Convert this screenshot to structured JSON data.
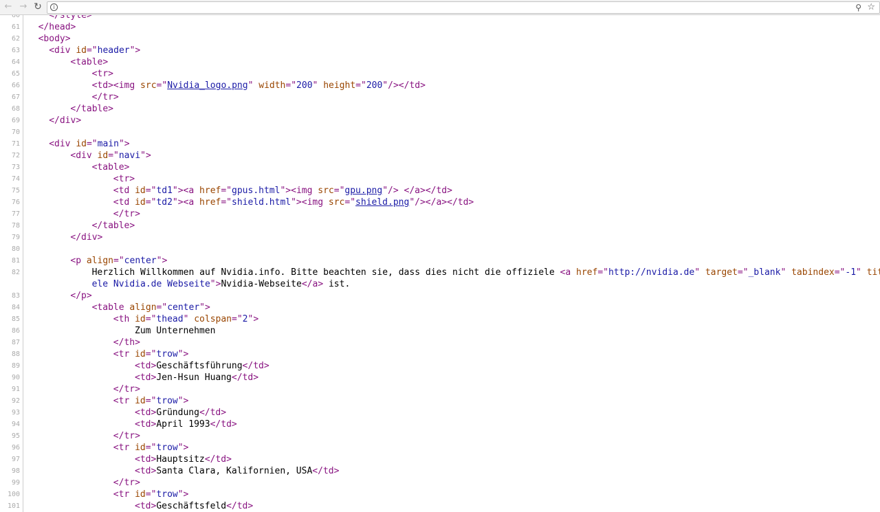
{
  "toolbar": {
    "back_icon": "back-arrow-icon",
    "forward_icon": "forward-arrow-icon",
    "reload_icon": "reload-icon",
    "info_icon": "info-icon",
    "zoom_icon": "zoom-icon",
    "bookmark_icon": "star-icon",
    "url": ""
  },
  "colors": {
    "tag": "#881280",
    "attr_name": "#994500",
    "attr_value": "#1a1aa6",
    "line_number": "#aaaaaa"
  },
  "lines": [
    {
      "n": "60",
      "indent": 4,
      "tokens": [
        [
          "t",
          "</style>"
        ]
      ]
    },
    {
      "n": "61",
      "indent": 2,
      "tokens": [
        [
          "t",
          "</head>"
        ]
      ]
    },
    {
      "n": "62",
      "indent": 2,
      "tokens": [
        [
          "t",
          "<body>"
        ]
      ]
    },
    {
      "n": "63",
      "indent": 4,
      "tokens": [
        [
          "t",
          "<div "
        ],
        [
          "a",
          "id"
        ],
        [
          "t",
          "=\""
        ],
        [
          "v",
          "header"
        ],
        [
          "t",
          "\">"
        ]
      ]
    },
    {
      "n": "64",
      "indent": 8,
      "tokens": [
        [
          "t",
          "<table>"
        ]
      ]
    },
    {
      "n": "65",
      "indent": 12,
      "tokens": [
        [
          "t",
          "<tr>"
        ]
      ]
    },
    {
      "n": "66",
      "indent": 12,
      "tokens": [
        [
          "t",
          "<td><img "
        ],
        [
          "a",
          "src"
        ],
        [
          "t",
          "=\""
        ],
        [
          "l",
          "Nvidia_logo.png"
        ],
        [
          "t",
          "\" "
        ],
        [
          "a",
          "width"
        ],
        [
          "t",
          "=\""
        ],
        [
          "v",
          "200"
        ],
        [
          "t",
          "\" "
        ],
        [
          "a",
          "height"
        ],
        [
          "t",
          "=\""
        ],
        [
          "v",
          "200"
        ],
        [
          "t",
          "\"/></td>"
        ]
      ]
    },
    {
      "n": "67",
      "indent": 12,
      "tokens": [
        [
          "t",
          "</tr>"
        ]
      ]
    },
    {
      "n": "68",
      "indent": 8,
      "tokens": [
        [
          "t",
          "</table>"
        ]
      ]
    },
    {
      "n": "69",
      "indent": 4,
      "tokens": [
        [
          "t",
          "</div>"
        ]
      ]
    },
    {
      "n": "70",
      "indent": 0,
      "tokens": []
    },
    {
      "n": "71",
      "indent": 4,
      "tokens": [
        [
          "t",
          "<div "
        ],
        [
          "a",
          "id"
        ],
        [
          "t",
          "=\""
        ],
        [
          "v",
          "main"
        ],
        [
          "t",
          "\">"
        ]
      ]
    },
    {
      "n": "72",
      "indent": 8,
      "tokens": [
        [
          "t",
          "<div "
        ],
        [
          "a",
          "id"
        ],
        [
          "t",
          "=\""
        ],
        [
          "v",
          "navi"
        ],
        [
          "t",
          "\">"
        ]
      ]
    },
    {
      "n": "73",
      "indent": 12,
      "tokens": [
        [
          "t",
          "<table>"
        ]
      ]
    },
    {
      "n": "74",
      "indent": 16,
      "tokens": [
        [
          "t",
          "<tr>"
        ]
      ]
    },
    {
      "n": "75",
      "indent": 16,
      "tokens": [
        [
          "t",
          "<td "
        ],
        [
          "a",
          "id"
        ],
        [
          "t",
          "=\""
        ],
        [
          "v",
          "td1"
        ],
        [
          "t",
          "\"><a "
        ],
        [
          "a",
          "href"
        ],
        [
          "t",
          "=\""
        ],
        [
          "v",
          "gpus.html"
        ],
        [
          "t",
          "\"><img "
        ],
        [
          "a",
          "src"
        ],
        [
          "t",
          "=\""
        ],
        [
          "l",
          "gpu.png"
        ],
        [
          "t",
          "\"/> </a></td>"
        ]
      ]
    },
    {
      "n": "76",
      "indent": 16,
      "tokens": [
        [
          "t",
          "<td "
        ],
        [
          "a",
          "id"
        ],
        [
          "t",
          "=\""
        ],
        [
          "v",
          "td2"
        ],
        [
          "t",
          "\"><a "
        ],
        [
          "a",
          "href"
        ],
        [
          "t",
          "=\""
        ],
        [
          "v",
          "shield.html"
        ],
        [
          "t",
          "\"><img "
        ],
        [
          "a",
          "src"
        ],
        [
          "t",
          "=\""
        ],
        [
          "l",
          "shield.png"
        ],
        [
          "t",
          "\"/></a></td>"
        ]
      ]
    },
    {
      "n": "77",
      "indent": 16,
      "tokens": [
        [
          "t",
          "</tr>"
        ]
      ]
    },
    {
      "n": "78",
      "indent": 12,
      "tokens": [
        [
          "t",
          "</table>"
        ]
      ]
    },
    {
      "n": "79",
      "indent": 8,
      "tokens": [
        [
          "t",
          "</div>"
        ]
      ]
    },
    {
      "n": "80",
      "indent": 0,
      "tokens": []
    },
    {
      "n": "81",
      "indent": 8,
      "tokens": [
        [
          "t",
          "<p "
        ],
        [
          "a",
          "align"
        ],
        [
          "t",
          "=\""
        ],
        [
          "v",
          "center"
        ],
        [
          "t",
          "\">"
        ]
      ]
    },
    {
      "n": "82",
      "indent": 12,
      "tokens": [
        [
          "x",
          "Herzlich Willkommen auf Nvidia.info. Bitte beachten sie, dass dies nicht die offiziele "
        ],
        [
          "t",
          "<a "
        ],
        [
          "a",
          "href"
        ],
        [
          "t",
          "=\""
        ],
        [
          "v",
          "http://nvidia.de"
        ],
        [
          "t",
          "\" "
        ],
        [
          "a",
          "target"
        ],
        [
          "t",
          "=\""
        ],
        [
          "v",
          "_blank"
        ],
        [
          "t",
          "\" "
        ],
        [
          "a",
          "tabindex"
        ],
        [
          "t",
          "=\""
        ],
        [
          "v",
          "-1"
        ],
        [
          "t",
          "\" "
        ],
        [
          "a",
          "title"
        ],
        [
          "t",
          "=\""
        ],
        [
          "v",
          "Offiziele Nvidia.de Webseite"
        ],
        [
          "t",
          "\">"
        ],
        [
          "x",
          "Nvidia-Webseite"
        ],
        [
          "t",
          "</a>"
        ],
        [
          "x",
          " ist."
        ]
      ]
    },
    {
      "n": "83",
      "indent": 8,
      "tokens": [
        [
          "t",
          "</p>"
        ]
      ]
    },
    {
      "n": "84",
      "indent": 12,
      "tokens": [
        [
          "t",
          "<table "
        ],
        [
          "a",
          "align"
        ],
        [
          "t",
          "=\""
        ],
        [
          "v",
          "center"
        ],
        [
          "t",
          "\">"
        ]
      ]
    },
    {
      "n": "85",
      "indent": 16,
      "tokens": [
        [
          "t",
          "<th "
        ],
        [
          "a",
          "id"
        ],
        [
          "t",
          "=\""
        ],
        [
          "v",
          "thead"
        ],
        [
          "t",
          "\" "
        ],
        [
          "a",
          "colspan"
        ],
        [
          "t",
          "=\""
        ],
        [
          "v",
          "2"
        ],
        [
          "t",
          "\">"
        ]
      ]
    },
    {
      "n": "86",
      "indent": 20,
      "tokens": [
        [
          "x",
          "Zum Unternehmen"
        ]
      ]
    },
    {
      "n": "87",
      "indent": 16,
      "tokens": [
        [
          "t",
          "</th>"
        ]
      ]
    },
    {
      "n": "88",
      "indent": 16,
      "tokens": [
        [
          "t",
          "<tr "
        ],
        [
          "a",
          "id"
        ],
        [
          "t",
          "=\""
        ],
        [
          "v",
          "trow"
        ],
        [
          "t",
          "\">"
        ]
      ]
    },
    {
      "n": "89",
      "indent": 20,
      "tokens": [
        [
          "t",
          "<td>"
        ],
        [
          "x",
          "Geschäftsführung"
        ],
        [
          "t",
          "</td>"
        ]
      ]
    },
    {
      "n": "90",
      "indent": 20,
      "tokens": [
        [
          "t",
          "<td>"
        ],
        [
          "x",
          "Jen-Hsun Huang"
        ],
        [
          "t",
          "</td>"
        ]
      ]
    },
    {
      "n": "91",
      "indent": 16,
      "tokens": [
        [
          "t",
          "</tr>"
        ]
      ]
    },
    {
      "n": "92",
      "indent": 16,
      "tokens": [
        [
          "t",
          "<tr "
        ],
        [
          "a",
          "id"
        ],
        [
          "t",
          "=\""
        ],
        [
          "v",
          "trow"
        ],
        [
          "t",
          "\">"
        ]
      ]
    },
    {
      "n": "93",
      "indent": 20,
      "tokens": [
        [
          "t",
          "<td>"
        ],
        [
          "x",
          "Gründung"
        ],
        [
          "t",
          "</td>"
        ]
      ]
    },
    {
      "n": "94",
      "indent": 20,
      "tokens": [
        [
          "t",
          "<td>"
        ],
        [
          "x",
          "April 1993"
        ],
        [
          "t",
          "</td>"
        ]
      ]
    },
    {
      "n": "95",
      "indent": 16,
      "tokens": [
        [
          "t",
          "</tr>"
        ]
      ]
    },
    {
      "n": "96",
      "indent": 16,
      "tokens": [
        [
          "t",
          "<tr "
        ],
        [
          "a",
          "id"
        ],
        [
          "t",
          "=\""
        ],
        [
          "v",
          "trow"
        ],
        [
          "t",
          "\">"
        ]
      ]
    },
    {
      "n": "97",
      "indent": 20,
      "tokens": [
        [
          "t",
          "<td>"
        ],
        [
          "x",
          "Hauptsitz"
        ],
        [
          "t",
          "</td>"
        ]
      ]
    },
    {
      "n": "98",
      "indent": 20,
      "tokens": [
        [
          "t",
          "<td>"
        ],
        [
          "x",
          "Santa Clara, Kalifornien, USA"
        ],
        [
          "t",
          "</td>"
        ]
      ]
    },
    {
      "n": "99",
      "indent": 16,
      "tokens": [
        [
          "t",
          "</tr>"
        ]
      ]
    },
    {
      "n": "100",
      "indent": 16,
      "tokens": [
        [
          "t",
          "<tr "
        ],
        [
          "a",
          "id"
        ],
        [
          "t",
          "=\""
        ],
        [
          "v",
          "trow"
        ],
        [
          "t",
          "\">"
        ]
      ]
    },
    {
      "n": "101",
      "indent": 20,
      "tokens": [
        [
          "t",
          "<td>"
        ],
        [
          "x",
          "Geschäftsfeld"
        ],
        [
          "t",
          "</td>"
        ]
      ]
    }
  ]
}
